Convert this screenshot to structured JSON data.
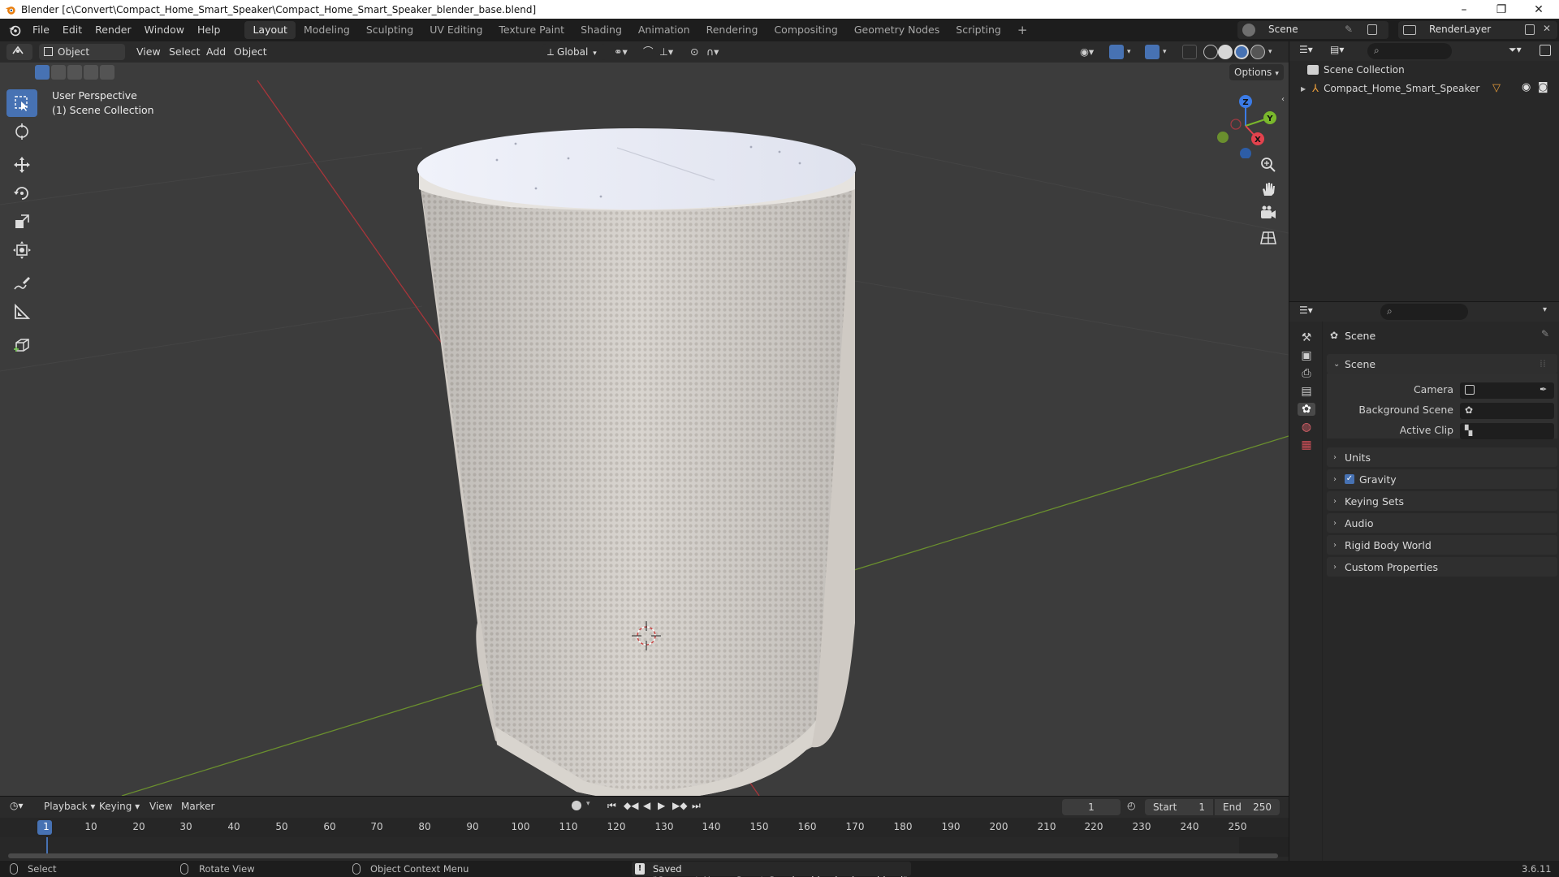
{
  "window": {
    "title": "Blender [c\\Convert\\Compact_Home_Smart_Speaker\\Compact_Home_Smart_Speaker_blender_base.blend]",
    "minimize": "–",
    "maximize": "❐",
    "close": "✕"
  },
  "menus": [
    "File",
    "Edit",
    "Render",
    "Window",
    "Help"
  ],
  "workspaces": [
    "Layout",
    "Modeling",
    "Sculpting",
    "UV Editing",
    "Texture Paint",
    "Shading",
    "Animation",
    "Rendering",
    "Compositing",
    "Geometry Nodes",
    "Scripting"
  ],
  "workspace_add": "+",
  "scene_selector": {
    "label": "Scene"
  },
  "renderlayer_selector": {
    "label": "RenderLayer"
  },
  "viewport_header": {
    "mode": "Object Mode",
    "menus": [
      "View",
      "Select",
      "Add",
      "Object"
    ],
    "transform_orientation": "Global",
    "options": "Options"
  },
  "viewport": {
    "perspective_label": "User Perspective",
    "collection_label": "(1) Scene Collection",
    "gizmo_axes": {
      "z": "Z",
      "y": "Y",
      "x": "X"
    },
    "colors": {
      "background": "#3c3c3c",
      "x_axis": "#a8353a",
      "y_axis": "#6a8f2e",
      "active_tool": "#4772b3"
    }
  },
  "outliner": {
    "root": "Scene Collection",
    "items": [
      {
        "label": "Compact_Home_Smart_Speaker"
      }
    ]
  },
  "properties": {
    "context_title": "Scene",
    "section_title": "Scene",
    "fields": [
      {
        "label": "Camera"
      },
      {
        "label": "Background Scene"
      },
      {
        "label": "Active Clip"
      }
    ],
    "panels": [
      "Units",
      "Gravity",
      "Keying Sets",
      "Audio",
      "Rigid Body World",
      "Custom Properties"
    ],
    "gravity_enabled": true
  },
  "timeline": {
    "menus": [
      "Playback",
      "Keying",
      "View",
      "Marker"
    ],
    "current_frame": "1",
    "start_label": "Start",
    "start_value": "1",
    "end_label": "End",
    "end_value": "250",
    "ruler_ticks": [
      "1",
      "10",
      "20",
      "30",
      "40",
      "50",
      "60",
      "70",
      "80",
      "90",
      "100",
      "110",
      "120",
      "130",
      "140",
      "150",
      "160",
      "170",
      "180",
      "190",
      "200",
      "210",
      "220",
      "230",
      "240",
      "250"
    ]
  },
  "statusbar": {
    "select": "Select",
    "rotate": "Rotate View",
    "context_menu": "Object Context Menu",
    "message": "Saved \"Compact_Home_Smart_Speaker_blender_base.blend\"",
    "version": "3.6.11"
  }
}
